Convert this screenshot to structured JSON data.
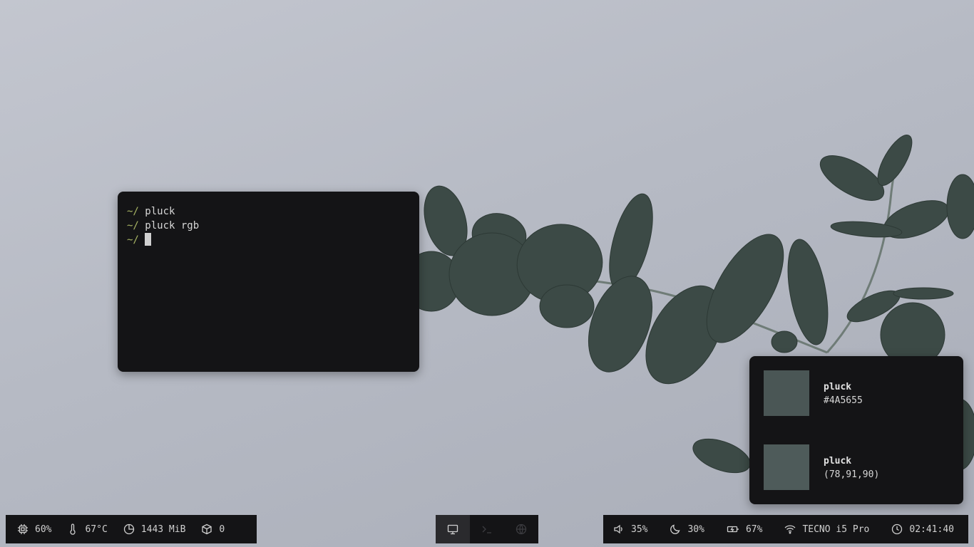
{
  "terminal": {
    "prompt": "~/",
    "lines": [
      "pluck",
      "pluck rgb"
    ]
  },
  "notifications": [
    {
      "title": "pluck",
      "body": "#4A5655",
      "swatch_color": "#4A5655"
    },
    {
      "title": "pluck",
      "body": "(78,91,90)",
      "swatch_color": "#4E5B5A"
    }
  ],
  "bar_left": {
    "cpu": {
      "icon": "cpu-icon",
      "value": "60%"
    },
    "temperature": {
      "icon": "thermometer-icon",
      "value": "67°C"
    },
    "memory": {
      "icon": "memory-pie-icon",
      "value": "1443 MiB"
    },
    "updates": {
      "icon": "package-icon",
      "value": "0"
    }
  },
  "workspaces": [
    {
      "icon": "desktop-icon",
      "active": true
    },
    {
      "icon": "terminal-icon",
      "active": false
    },
    {
      "icon": "globe-icon",
      "active": false
    }
  ],
  "bar_right": {
    "volume": {
      "icon": "speaker-icon",
      "value": "35%"
    },
    "brightness": {
      "icon": "moon-icon",
      "value": "30%"
    },
    "battery": {
      "icon": "battery-charging-icon",
      "value": "67%"
    },
    "wifi": {
      "icon": "wifi-icon",
      "value": "TECNO i5 Pro"
    },
    "clock": {
      "icon": "clock-icon",
      "value": "02:41:40"
    }
  },
  "colors": {
    "bar_bg": "#141416",
    "prompt": "#a9b665",
    "text": "#d0d0d0",
    "leaf": "#3b4a45"
  }
}
